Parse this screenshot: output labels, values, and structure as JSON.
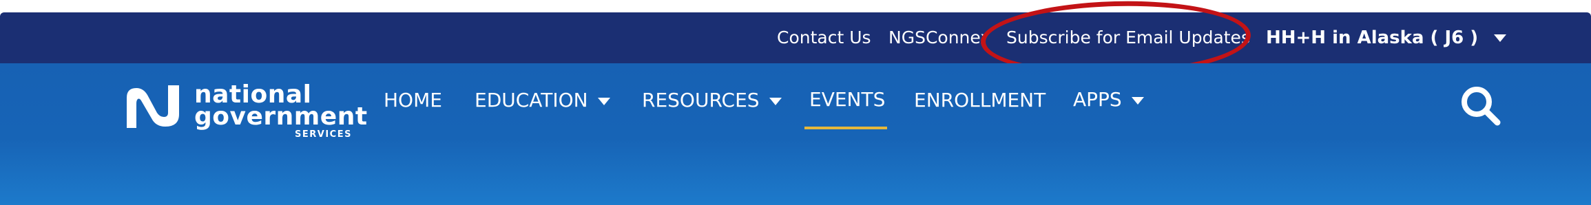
{
  "top_bar": {
    "contact_label": "Contact Us",
    "ngsconnex_label": "NGSConnex",
    "subscribe_label": "Subscribe for Email Updates",
    "region": {
      "prefix": "HH+H in ",
      "state": "Alaska",
      "code": " ( J6 )"
    },
    "background": "#1b2f73",
    "highlight_color": "#c31316"
  },
  "logo": {
    "line1": "national",
    "line2": "government",
    "line3": "SERVICES"
  },
  "nav": {
    "home": "HOME",
    "education": "EDUCATION",
    "resources": "RESOURCES",
    "events": "EVENTS",
    "enrollment": "ENROLLMENT",
    "apps": "APPS",
    "active_item": "EVENTS",
    "active_underline_color": "#e5b83c",
    "background": "#1764b6"
  },
  "icons": {
    "search": "search-icon",
    "logo_mark": "ngs-logo-mark-icon",
    "dropdown": "chevron-down-icon"
  }
}
